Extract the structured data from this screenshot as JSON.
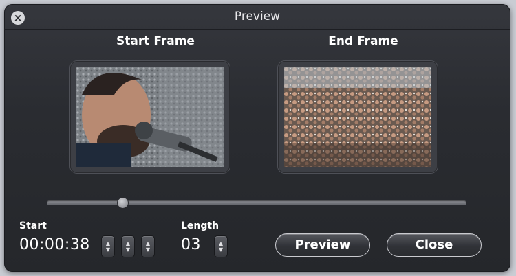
{
  "window": {
    "title": "Preview",
    "close_glyph": "×"
  },
  "frames": {
    "start_label": "Start Frame",
    "end_label": "End Frame"
  },
  "scrubber": {
    "position_fraction": 0.18
  },
  "start": {
    "label": "Start",
    "value": "00:00:38"
  },
  "length": {
    "label": "Length",
    "value": "03"
  },
  "buttons": {
    "preview": "Preview",
    "close": "Close"
  },
  "icons": {
    "close": "close-circle-icon",
    "stepper": "up-down-stepper-icon"
  },
  "colors": {
    "panel_background": "#2a2c31",
    "text": "#ffffff",
    "button_border": "#c9cacf"
  }
}
